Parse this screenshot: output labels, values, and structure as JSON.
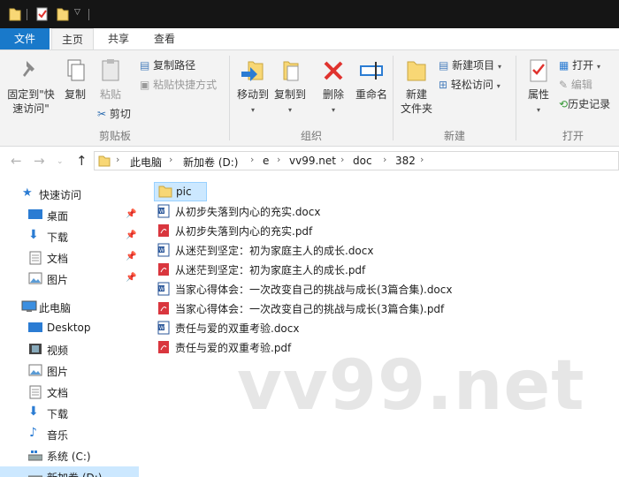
{
  "ribbon_tabs": [
    "文件",
    "主页",
    "共享",
    "查看"
  ],
  "ribbon": {
    "pin_label_1": "固定到\"快",
    "pin_label_2": "速访问\"",
    "copy": "复制",
    "paste": "粘贴",
    "copy_path": "复制路径",
    "paste_shortcut": "粘贴快捷方式",
    "cut": "剪切",
    "clipboard_group": "剪贴板",
    "move_to": "移动到",
    "copy_to": "复制到",
    "delete": "删除",
    "rename": "重命名",
    "organize_group": "组织",
    "new_folder_1": "新建",
    "new_folder_2": "文件夹",
    "new_item": "新建项目",
    "easy_access": "轻松访问",
    "new_group": "新建",
    "properties": "属性",
    "open": "打开",
    "edit": "编辑",
    "history": "历史记录",
    "open_group": "打开"
  },
  "address": {
    "crumbs": [
      "此电脑",
      "新加卷 (D:)",
      "e",
      "vv99.net",
      "doc",
      "382"
    ]
  },
  "nav_pane": {
    "quick_access": "快速访问",
    "quick_items": [
      "桌面",
      "下载",
      "文档",
      "图片"
    ],
    "this_pc": "此电脑",
    "pc_items": [
      "Desktop",
      "视频",
      "图片",
      "文档",
      "下载",
      "音乐",
      "系统 (C:)",
      "新加卷 (D:)"
    ]
  },
  "files": [
    {
      "name": "pic",
      "type": "folder"
    },
    {
      "name": "从初步失落到内心的充实.docx",
      "type": "docx"
    },
    {
      "name": "从初步失落到内心的充实.pdf",
      "type": "pdf"
    },
    {
      "name": "从迷茫到坚定：初为家庭主人的成长.docx",
      "type": "docx"
    },
    {
      "name": "从迷茫到坚定：初为家庭主人的成长.pdf",
      "type": "pdf"
    },
    {
      "name": "当家心得体会：一次改变自己的挑战与成长(3篇合集).docx",
      "type": "docx"
    },
    {
      "name": "当家心得体会：一次改变自己的挑战与成长(3篇合集).pdf",
      "type": "pdf"
    },
    {
      "name": "责任与爱的双重考验.docx",
      "type": "docx"
    },
    {
      "name": "责任与爱的双重考验.pdf",
      "type": "pdf"
    }
  ],
  "watermark": "vv99.net",
  "colors": {
    "accent": "#1979ca",
    "selection": "#cce8ff",
    "folder": "#f8d775",
    "pdf": "#d9363e",
    "docx": "#2b579a"
  }
}
